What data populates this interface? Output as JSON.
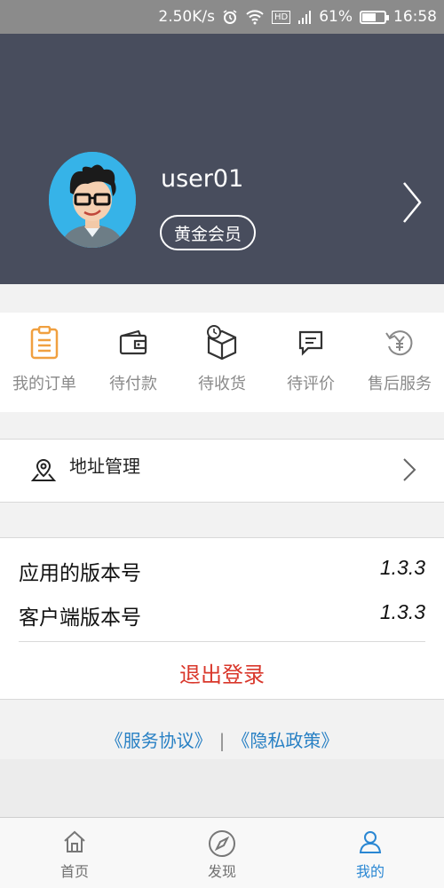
{
  "status_bar": {
    "speed": "2.50K/s",
    "hd": "HD",
    "battery": "61%",
    "battery_level": 0.61,
    "time": "16:58"
  },
  "profile": {
    "username": "user01",
    "badge": "黄金会员"
  },
  "orders": {
    "items": [
      {
        "label": "我的订单",
        "icon": "clipboard-icon"
      },
      {
        "label": "待付款",
        "icon": "wallet-icon"
      },
      {
        "label": "待收货",
        "icon": "package-icon"
      },
      {
        "label": "待评价",
        "icon": "comment-icon"
      },
      {
        "label": "售后服务",
        "icon": "yen-refresh-icon"
      }
    ]
  },
  "address": {
    "label": "地址管理"
  },
  "info": {
    "app_version_label": "应用的版本号",
    "app_version": "1.3.3",
    "client_version_label": "客户端版本号",
    "client_version": "1.3.3",
    "logout": "退出登录"
  },
  "links": {
    "service": "《服务协议》",
    "separator": "|",
    "privacy": "《隐私政策》"
  },
  "tabbar": {
    "tabs": [
      {
        "label": "首页",
        "icon": "home-icon",
        "active": false
      },
      {
        "label": "发现",
        "icon": "compass-icon",
        "active": false
      },
      {
        "label": "我的",
        "icon": "user-icon",
        "active": true
      }
    ]
  },
  "colors": {
    "header_bg": "#484d5d",
    "accent_orange": "#f0a040",
    "logout_red": "#d9372b",
    "link_blue": "#2880c4",
    "active_tab": "#2a87d3"
  }
}
